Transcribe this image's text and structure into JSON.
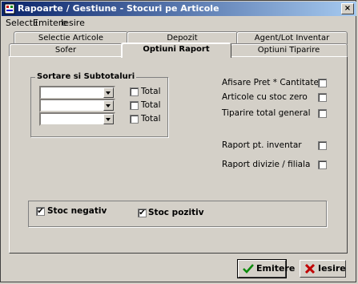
{
  "window": {
    "title": "Rapoarte / Gestiune - Stocuri pe Articole",
    "close_glyph": "×"
  },
  "menu": [
    "Selectii",
    "Emitere",
    "Iesire"
  ],
  "tabs_back": [
    "Selectie Articole",
    "Depozit",
    "Agent/Lot Inventar"
  ],
  "tabs_front": [
    "Sofer",
    "Optiuni Raport",
    "Optiuni Tiparire"
  ],
  "active_tab": "Optiuni Raport",
  "sort_group": {
    "title": "Sortare si Subtotaluri",
    "rows": [
      {
        "value": "",
        "total_label": "Total",
        "total_checked": false
      },
      {
        "value": "",
        "total_label": "Total",
        "total_checked": false
      },
      {
        "value": "",
        "total_label": "Total",
        "total_checked": false
      }
    ]
  },
  "options": [
    {
      "label": "Afisare Pret * Cantitate",
      "checked": false
    },
    {
      "label": "Articole cu stoc zero",
      "checked": false
    },
    {
      "label": "Tiparire total general",
      "checked": false
    },
    {
      "label": "Raport pt. inventar",
      "checked": false
    },
    {
      "label": "Raport divizie / filiala",
      "checked": false
    }
  ],
  "stock_group": {
    "negativ": {
      "label": "Stoc negativ",
      "checked": true
    },
    "pozitiv": {
      "label": "Stoc pozitiv",
      "checked": true
    }
  },
  "buttons": {
    "emit": "Emitere",
    "exit": "Iesire"
  },
  "check_glyph": "✔"
}
